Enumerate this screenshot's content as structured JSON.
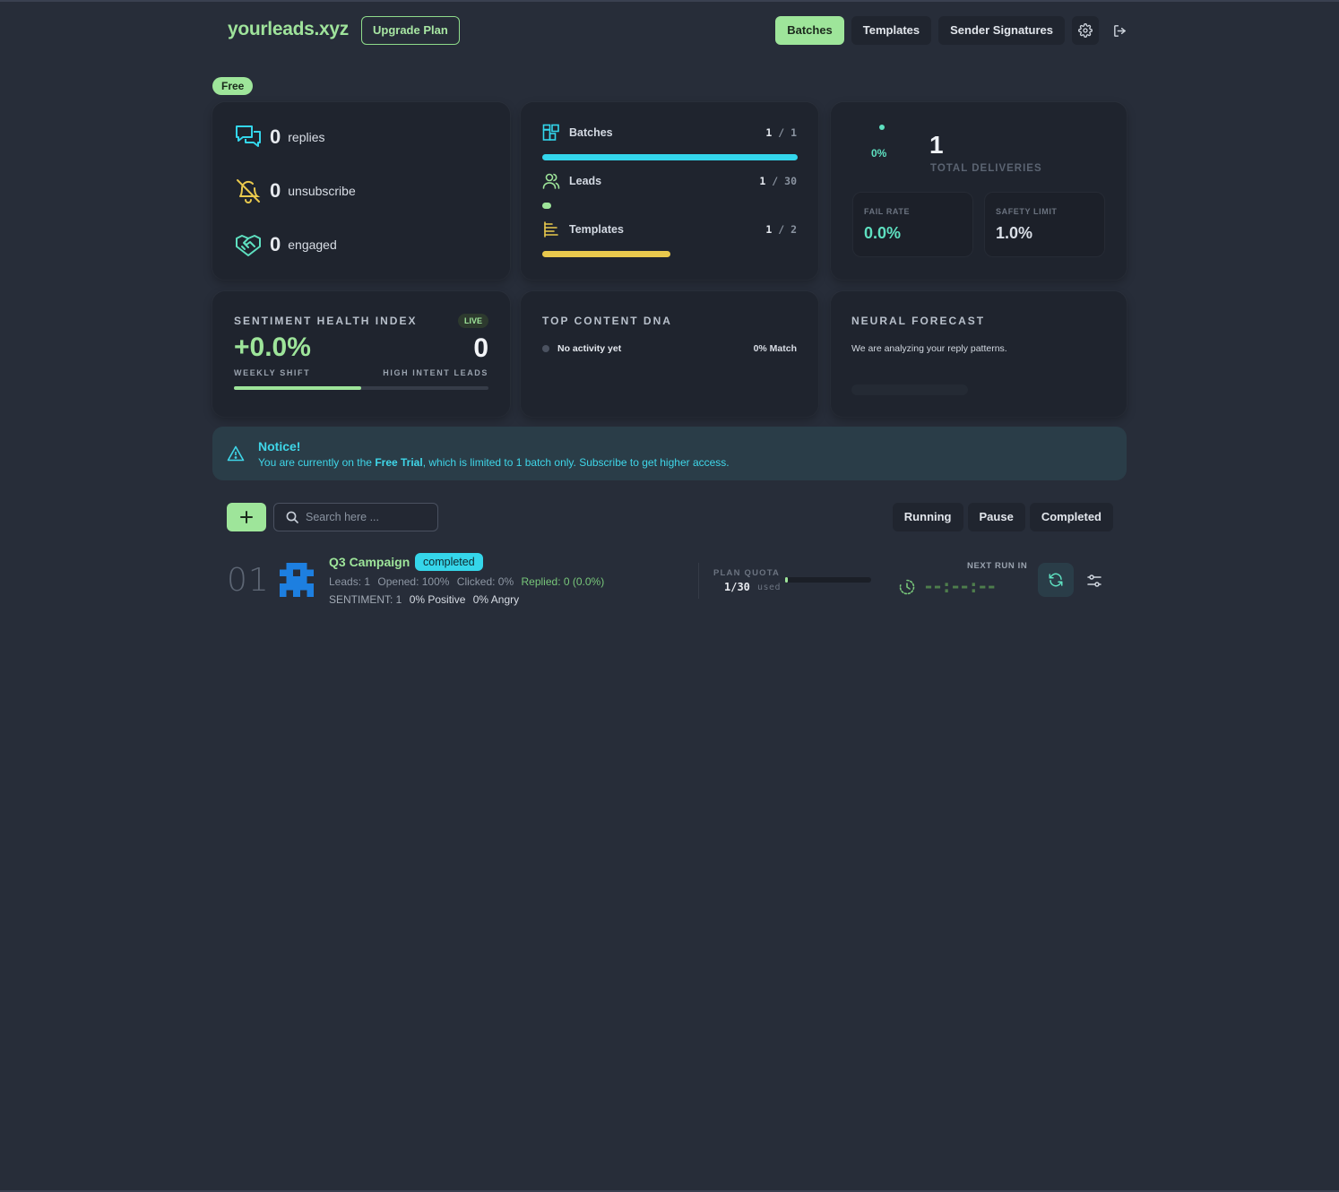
{
  "header": {
    "logo": "yourleads.xyz",
    "upgrade_label": "Upgrade Plan",
    "nav": [
      {
        "label": "Batches",
        "active": true
      },
      {
        "label": "Templates",
        "active": false
      },
      {
        "label": "Sender Signatures",
        "active": false
      }
    ],
    "settings_icon": "gear-icon",
    "logout_icon": "logout-icon"
  },
  "plan_badge": "Free",
  "engagement": {
    "replies": {
      "value": "0",
      "label": "replies",
      "icon": "chat-icon"
    },
    "unsubscribe": {
      "value": "0",
      "label": "unsubscribe",
      "icon": "bell-off-icon"
    },
    "engaged": {
      "value": "0",
      "label": "engaged",
      "icon": "handshake-icon"
    }
  },
  "usage": {
    "batches": {
      "label": "Batches",
      "used": "1",
      "sep": "/",
      "max": "1",
      "fraction": 1.0,
      "color": "#33d6ec",
      "icon": "batches-icon"
    },
    "leads": {
      "label": "Leads",
      "used": "1",
      "sep": "/",
      "max": "30",
      "fraction": 0.033,
      "color": "#9ee59a",
      "icon": "users-icon"
    },
    "templates": {
      "label": "Templates",
      "used": "1",
      "sep": "/",
      "max": "2",
      "fraction": 0.5,
      "color": "#e9c94d",
      "icon": "templates-icon"
    }
  },
  "deliveries": {
    "gauge_percent": "0%",
    "total": "1",
    "total_label": "TOTAL DELIVERIES",
    "fail_rate_label": "FAIL RATE",
    "fail_rate": "0.0%",
    "safety_limit_label": "SAFETY LIMIT",
    "safety_limit": "1.0%",
    "fail_color": "#5ee0c0",
    "safety_color": "#d9dee6"
  },
  "sentiment": {
    "title": "SENTIMENT HEALTH INDEX",
    "badge": "LIVE",
    "weekly_shift": "+0.0%",
    "weekly_shift_label": "WEEKLY SHIFT",
    "high_intent": "0",
    "high_intent_label": "HIGH INTENT LEADS",
    "bar_fraction": 0.5
  },
  "content_dna": {
    "title": "TOP CONTENT DNA",
    "item": "No activity yet",
    "match": "0% Match"
  },
  "forecast": {
    "title": "NEURAL FORECAST",
    "text": "We are analyzing your reply patterns."
  },
  "notice": {
    "title": "Notice!",
    "text_before": "You are currently on the ",
    "highlight": "Free Trial",
    "text_after": ", which is limited to 1 batch only. Subscribe to get higher access.",
    "icon": "warning-icon"
  },
  "toolbar": {
    "add_icon": "plus-icon",
    "search_placeholder": "Search here ...",
    "search_icon": "search-icon",
    "filters": [
      "Running",
      "Pause",
      "Completed"
    ]
  },
  "batches": [
    {
      "index": "01",
      "name": "Q3 Campaign",
      "status": "completed",
      "leads": "Leads: 1",
      "opened": "Opened: 100%",
      "clicked": "Clicked: 0%",
      "replied": "Replied: 0 (0.0%)",
      "sentiment_label": "SENTIMENT: 1",
      "positive": "0% Positive",
      "angry": "0% Angry",
      "quota_label": "PLAN QUOTA",
      "quota_value": "1/30",
      "quota_used_label": "used",
      "quota_fraction": 0.033,
      "next_run_label": "NEXT RUN IN",
      "next_run_value": "--:--:--"
    }
  ]
}
